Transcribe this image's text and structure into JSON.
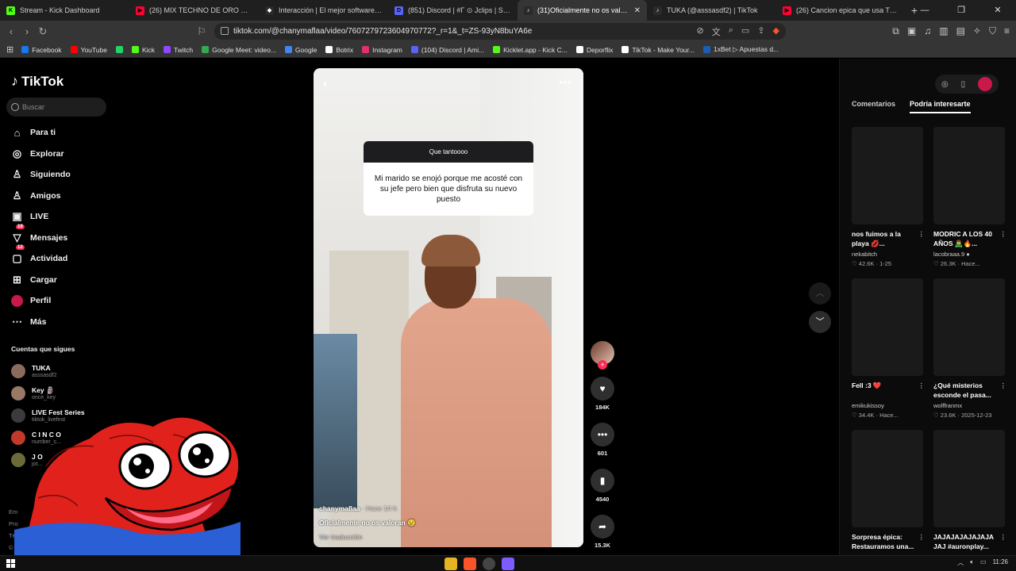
{
  "browser": {
    "tabs": [
      {
        "title": "Stream - Kick Dashboard",
        "color": "#53fc18",
        "letter": "K"
      },
      {
        "title": "(26) MIX TECHNO DE ORO DE 80's & ...",
        "color": "#ff0033",
        "letter": "▶"
      },
      {
        "title": "Interacción | El mejor software para ...",
        "color": "#ffffff",
        "letter": "◆"
      },
      {
        "title": "(851) Discord | #Γ ⊙ Jclips | SAPOLIC...",
        "color": "#5865f2",
        "letter": "D"
      },
      {
        "title": "(31)Oficialmente no os valora...",
        "color": "#ffffff",
        "letter": "♪",
        "active": true
      },
      {
        "title": "TUKA (@asssasdf2) | TikTok",
        "color": "#ffffff",
        "letter": "♪"
      },
      {
        "title": "(26) Cancion epica que usa TheGref...",
        "color": "#ff0033",
        "letter": "▶"
      }
    ],
    "url": "tiktok.com/@chanymaflaa/video/7607279723604970772?_r=1&_t=ZS-93yN8buYA6e",
    "bookmarks": [
      {
        "label": "Facebook",
        "color": "#1877f2"
      },
      {
        "label": "YouTube",
        "color": "#ff0000"
      },
      {
        "label": "",
        "color": "#25d366"
      },
      {
        "label": "Kick",
        "color": "#53fc18"
      },
      {
        "label": "Twitch",
        "color": "#9146ff"
      },
      {
        "label": "Google Meet: video...",
        "color": "#34a853"
      },
      {
        "label": "Google",
        "color": "#4285f4"
      },
      {
        "label": "Botrix",
        "color": "#ffffff"
      },
      {
        "label": "Instagram",
        "color": "#e1306c"
      },
      {
        "label": "(104) Discord | Ami...",
        "color": "#5865f2"
      },
      {
        "label": "Kicklet.app - Kick C...",
        "color": "#53fc18"
      },
      {
        "label": "Deporflix",
        "color": "#ffffff"
      },
      {
        "label": "TikTok - Make Your...",
        "color": "#ffffff"
      },
      {
        "label": "1xBet ▷ Apuestas d...",
        "color": "#1a5fb4"
      }
    ]
  },
  "tiktok": {
    "brand": "TikTok",
    "search_placeholder": "Buscar",
    "nav": [
      {
        "label": "Para ti",
        "icon": "home-icon",
        "glyph": "⌂"
      },
      {
        "label": "Explorar",
        "icon": "compass-icon",
        "glyph": "◎"
      },
      {
        "label": "Siguiendo",
        "icon": "following-icon",
        "glyph": "♙"
      },
      {
        "label": "Amigos",
        "icon": "friends-icon",
        "glyph": "♙"
      },
      {
        "label": "LIVE",
        "icon": "live-icon",
        "glyph": "▣"
      },
      {
        "label": "Mensajes",
        "icon": "messages-icon",
        "glyph": "▽",
        "badge": "19"
      },
      {
        "label": "Actividad",
        "icon": "activity-icon",
        "glyph": "▢",
        "badge": "12"
      },
      {
        "label": "Cargar",
        "icon": "upload-icon",
        "glyph": "⊞"
      },
      {
        "label": "Perfil",
        "icon": "profile-icon",
        "glyph": "●"
      },
      {
        "label": "Más",
        "icon": "more-icon",
        "glyph": "⋯"
      }
    ],
    "following_heading": "Cuentas que sigues",
    "following": [
      {
        "name": "TUKA",
        "user": "asssasdf2",
        "color": "#8b6b5c"
      },
      {
        "name": "Key 🗿",
        "user": "once_key",
        "color": "#9a7866"
      },
      {
        "name": "LIVE Fest Series",
        "user": "tiktok_livefest",
        "color": "#3b3b3b"
      },
      {
        "name": "C I N C O",
        "user": "number_c...",
        "color": "#c0392b"
      },
      {
        "name": "J O",
        "user": "jot...",
        "color": "#6b6b3a"
      }
    ],
    "footer": [
      "Em",
      "Pro",
      "Tér",
      "©"
    ]
  },
  "video": {
    "question_header": "Que tantoooo",
    "question_text": "Mi marido se enojó porque me acosté con su jefe pero bien que disfruta su nuevo puesto",
    "author": "chanymaflaa",
    "time": " · Hace 14 h",
    "caption": "Oficialmente no os valoran 😢",
    "translate": "Ver traducción",
    "likes": "184K",
    "comments": "601",
    "saves": "4540",
    "shares": "15.3K"
  },
  "panel": {
    "tabs": [
      "Comentarios",
      "Podría interesarte"
    ],
    "cards": [
      {
        "title": "nos fuimos a la playa 💋...",
        "author": "nekabitch",
        "meta": "♡ 42.6K · 1-25"
      },
      {
        "title": "MODRIC A LOS 40 AÑOS 🧟‍♂️🔥...",
        "author": "lacobraaa.9 ●",
        "meta": "♡ 26.3K · Hace..."
      },
      {
        "title": "Fell :3 ❤️",
        "author": "emikukissoy",
        "meta": "♡ 34.4K · Hace..."
      },
      {
        "title": "¿Qué misterios esconde el pasa...",
        "author": "wolffranmx",
        "meta": "♡ 23.6K · 2025-12-23"
      },
      {
        "title": "Sorpresa épica: Restauramos una...",
        "author": "",
        "meta": ""
      },
      {
        "title": "JAJAJAJAJAJAJA JAJ #auronplay...",
        "author": "",
        "meta": ""
      }
    ]
  },
  "taskbar": {
    "time": "11:26"
  }
}
